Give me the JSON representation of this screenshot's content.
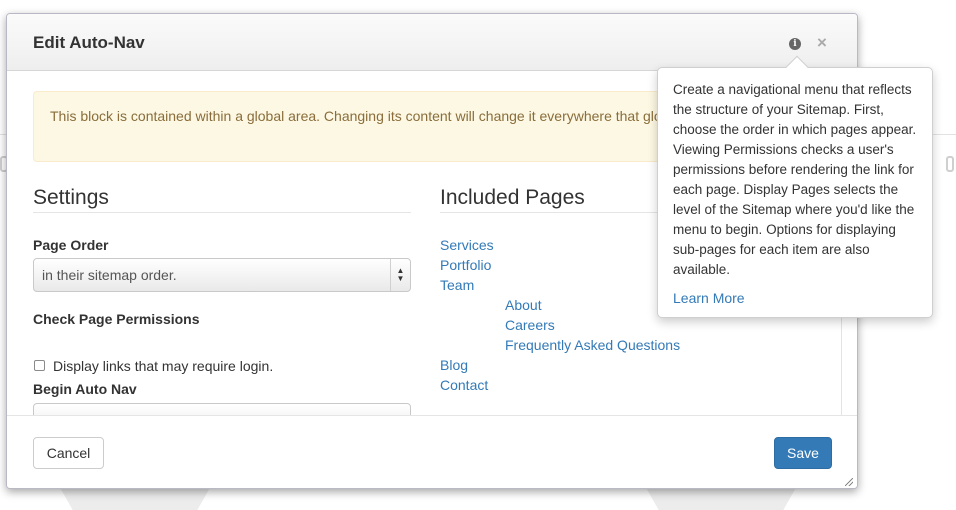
{
  "dialog": {
    "title": "Edit Auto-Nav",
    "info_icon": "info-circle-icon",
    "close_icon": "close-icon"
  },
  "alert": {
    "text": "This block is contained within a global area. Changing its content will change it everywhere that global area is referenced."
  },
  "settings": {
    "title": "Settings",
    "page_order": {
      "label": "Page Order",
      "value": "in their sitemap order."
    },
    "check_permissions": {
      "label": "Check Page Permissions",
      "checkbox_label": "Display links that may require login.",
      "checked": false
    },
    "begin_auto_nav": {
      "label": "Begin Auto Nav"
    }
  },
  "included_pages": {
    "title": "Included Pages",
    "pages": [
      {
        "label": "Services",
        "level": 0
      },
      {
        "label": "Portfolio",
        "level": 0
      },
      {
        "label": "Team",
        "level": 0
      },
      {
        "label": "About",
        "level": 1
      },
      {
        "label": "Careers",
        "level": 1
      },
      {
        "label": "Frequently Asked Questions",
        "level": 1
      },
      {
        "label": "Blog",
        "level": 0
      },
      {
        "label": "Contact",
        "level": 0
      }
    ]
  },
  "footer": {
    "cancel_label": "Cancel",
    "save_label": "Save"
  },
  "popover": {
    "text": "Create a navigational menu that reflects the structure of your Sitemap. First, choose the order in which pages appear. Viewing Permissions checks a user's permissions before rendering the link for each page. Display Pages selects the level of the Sitemap where you'd like the menu to begin. Options for displaying sub-pages for each item are also available.",
    "link_label": "Learn More"
  },
  "colors": {
    "primary": "#337ab7",
    "alert_bg": "#fcf8e3",
    "alert_text": "#8a6d3b"
  }
}
